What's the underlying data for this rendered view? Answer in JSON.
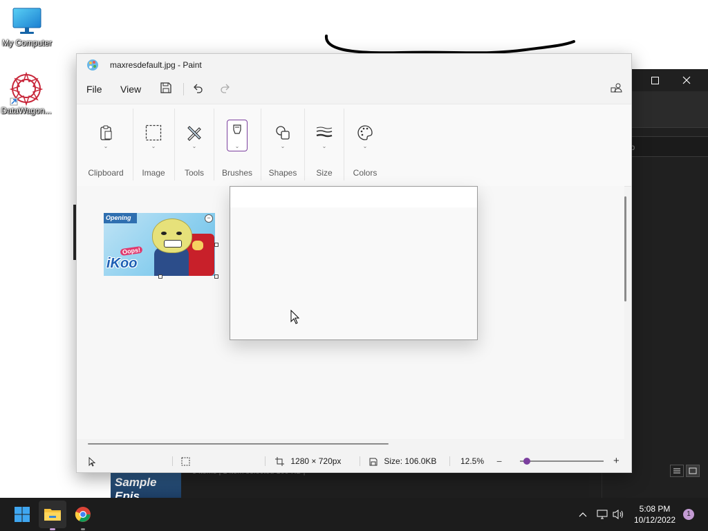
{
  "desktop": {
    "icons": [
      {
        "label": "My Computer"
      },
      {
        "label": "DataWagon..."
      }
    ]
  },
  "background_window": {
    "search_placeholder": "op",
    "status_text": "3 items  |  1 item selected  109 KB  |",
    "thumbnail_text": "Sample Epis"
  },
  "paint": {
    "title": "maxresdefault.jpg - Paint",
    "menu": {
      "file": "File",
      "view": "View"
    },
    "ribbon": {
      "groups": [
        {
          "label": "Clipboard",
          "icon": "clipboard-icon"
        },
        {
          "label": "Image",
          "icon": "selection-icon"
        },
        {
          "label": "Tools",
          "icon": "tools-icon"
        },
        {
          "label": "Brushes",
          "icon": "brush-icon"
        },
        {
          "label": "Shapes",
          "icon": "shapes-icon"
        },
        {
          "label": "Size",
          "icon": "size-icon"
        },
        {
          "label": "Colors",
          "icon": "palette-icon"
        }
      ]
    },
    "image": {
      "badge": "Opening",
      "logo_top": "Oops!",
      "logo_main": "iKoo"
    },
    "status": {
      "dimensions": "1280 × 720px",
      "size": "Size: 106.0KB",
      "zoom": "12.5%",
      "zoom_level": 0.08
    }
  },
  "taskbar": {
    "time": "5:08 PM",
    "date": "10/12/2022",
    "notifications": "1"
  },
  "colors": {
    "accent": "#7b3f9e",
    "taskbar_bg": "#1c1c1c",
    "window_dark": "#202020"
  }
}
